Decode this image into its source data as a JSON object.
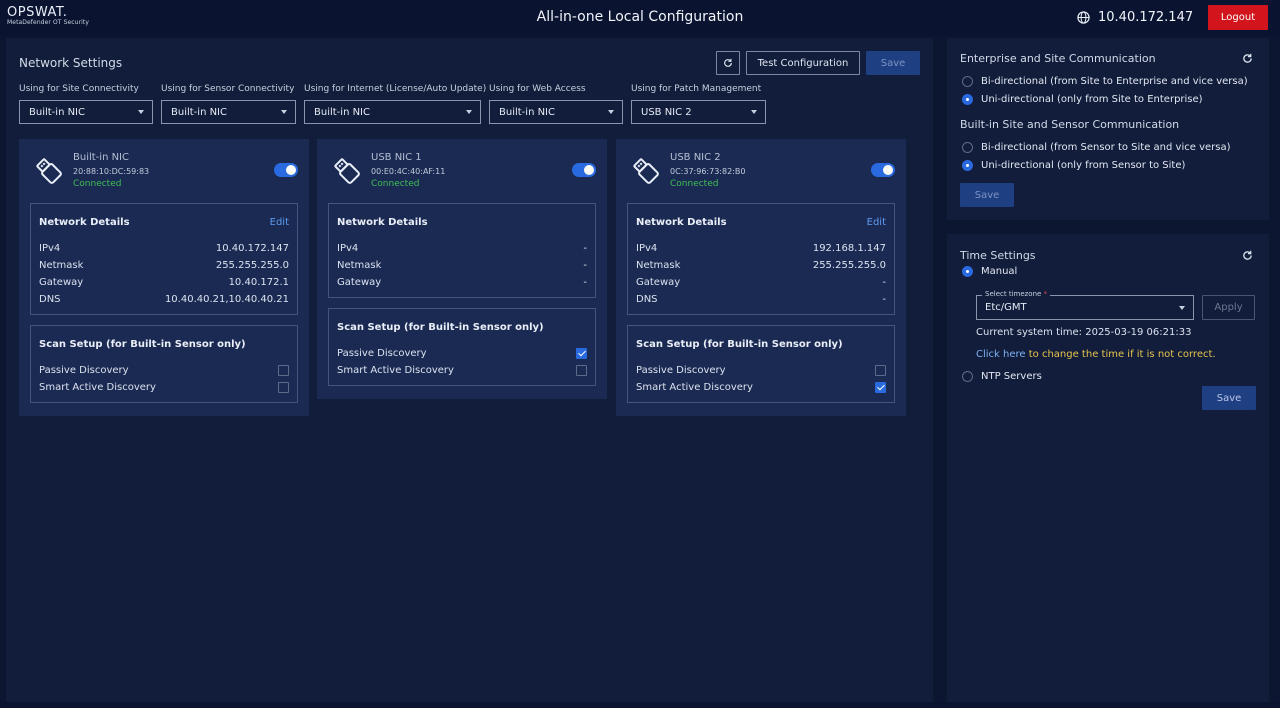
{
  "header": {
    "logo_main": "OPSWAT.",
    "logo_sub": "MetaDefender OT Security",
    "title": "All-in-one Local Configuration",
    "ip": "10.40.172.147",
    "logout_label": "Logout"
  },
  "network": {
    "title": "Network Settings",
    "test_label": "Test Configuration",
    "save_label": "Save",
    "selects": [
      {
        "label": "Using for Site Connectivity",
        "value": "Built-in NIC"
      },
      {
        "label": "Using for Sensor Connectivity",
        "value": "Built-in NIC"
      },
      {
        "label": "Using for Internet (License/Auto Update)",
        "value": "Built-in NIC"
      },
      {
        "label": "Using for Web Access",
        "value": "Built-in NIC"
      },
      {
        "label": "Using for Patch Management",
        "value": "USB NIC 2"
      }
    ],
    "nics": [
      {
        "name": "Built-in NIC",
        "mac": "20:88:10:DC:59:83",
        "status": "Connected",
        "enabled": true,
        "details_title": "Network Details",
        "edit_label": "Edit",
        "details": [
          {
            "k": "IPv4",
            "v": "10.40.172.147"
          },
          {
            "k": "Netmask",
            "v": "255.255.255.0"
          },
          {
            "k": "Gateway",
            "v": "10.40.172.1"
          },
          {
            "k": "DNS",
            "v": "10.40.40.21,10.40.40.21"
          }
        ],
        "scan_title": "Scan Setup (for Built-in Sensor only)",
        "scan": [
          {
            "label": "Passive Discovery",
            "checked": false
          },
          {
            "label": "Smart Active Discovery",
            "checked": false
          }
        ]
      },
      {
        "name": "USB NIC 1",
        "mac": "00:E0:4C:40:AF:11",
        "status": "Connected",
        "enabled": true,
        "details_title": "Network Details",
        "edit_label": "",
        "details": [
          {
            "k": "IPv4",
            "v": "-"
          },
          {
            "k": "Netmask",
            "v": "-"
          },
          {
            "k": "Gateway",
            "v": "-"
          }
        ],
        "scan_title": "Scan Setup (for Built-in Sensor only)",
        "scan": [
          {
            "label": "Passive Discovery",
            "checked": true
          },
          {
            "label": "Smart Active Discovery",
            "checked": false
          }
        ]
      },
      {
        "name": "USB NIC 2",
        "mac": "0C:37:96:73:82:B0",
        "status": "Connected",
        "enabled": true,
        "details_title": "Network Details",
        "edit_label": "Edit",
        "details": [
          {
            "k": "IPv4",
            "v": "192.168.1.147"
          },
          {
            "k": "Netmask",
            "v": "255.255.255.0"
          },
          {
            "k": "Gateway",
            "v": "-"
          },
          {
            "k": "DNS",
            "v": "-"
          }
        ],
        "scan_title": "Scan Setup (for Built-in Sensor only)",
        "scan": [
          {
            "label": "Passive Discovery",
            "checked": false
          },
          {
            "label": "Smart Active Discovery",
            "checked": true
          }
        ]
      }
    ]
  },
  "enterprise": {
    "title": "Enterprise and Site Communication",
    "opt_bi": "Bi-directional (from Site to Enterprise and vice versa)",
    "opt_uni": "Uni-directional (only from Site to Enterprise)",
    "selected": "uni",
    "sensor_title": "Built-in Site and Sensor Communication",
    "sensor_opt_bi": "Bi-directional (from Sensor to Site and vice versa)",
    "sensor_opt_uni": "Uni-directional (only from Sensor to Site)",
    "sensor_selected": "uni",
    "save_label": "Save"
  },
  "time": {
    "title": "Time Settings",
    "manual_label": "Manual",
    "tz_label": "Select timezone",
    "tz_required": "*",
    "tz_value": "Etc/GMT",
    "apply_label": "Apply",
    "current_label": "Current system time:",
    "current_value": "2025-03-19 06:21:33",
    "click_here": "Click here",
    "click_rest": "to change the time if it is not correct.",
    "ntp_label": "NTP Servers",
    "save_label": "Save"
  },
  "colors": {
    "accent": "#2a6ae0",
    "connected": "#3fbe53",
    "logout": "#d2141c",
    "warning_text": "#e8c34c"
  },
  "icons": [
    "globe-icon",
    "refresh-icon",
    "usb-icon",
    "chevron-down-icon"
  ]
}
